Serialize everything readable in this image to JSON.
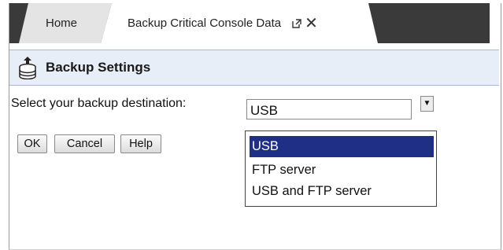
{
  "tabs": [
    {
      "label": "Home"
    },
    {
      "label": "Backup Critical Console Data",
      "active": true
    }
  ],
  "panel": {
    "title": "Backup Settings",
    "icon": "database-backup-icon"
  },
  "form": {
    "destination_label": "Select your backup destination:",
    "destination_value": "USB",
    "destination_options": [
      "USB",
      "FTP server",
      "USB and FTP server"
    ]
  },
  "buttons": {
    "ok": "OK",
    "cancel": "Cancel",
    "help": "Help"
  },
  "colors": {
    "tab_bar": "#3a3a3a",
    "header_bg": "#e8eef7",
    "header_border": "#a5b9d8",
    "selected_option_bg": "#1f2f86"
  }
}
